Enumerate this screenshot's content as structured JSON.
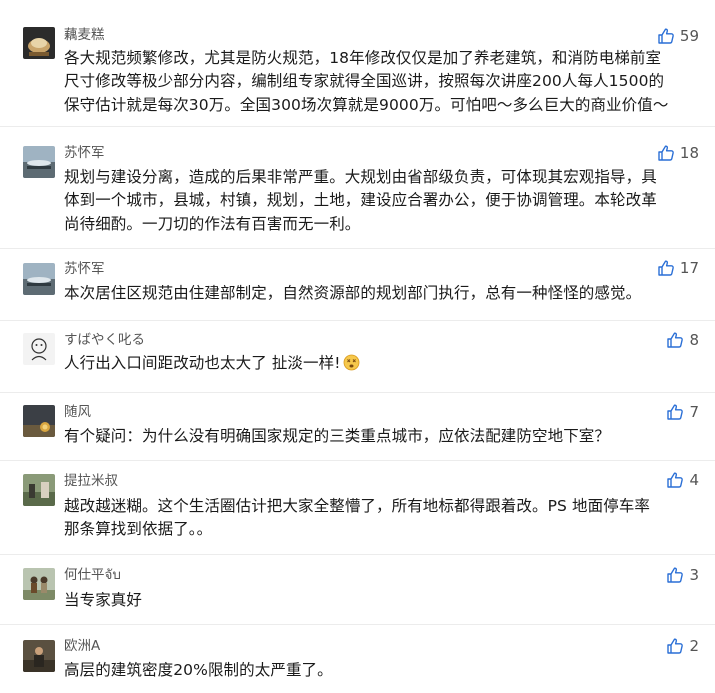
{
  "comments": [
    {
      "username": "藕麦糕",
      "likes": "59",
      "lines": [
        "各大规范频繁修改，尤其是防火规范，18年修改仅仅是加了养老建筑，和消防电梯前室",
        "尺寸修改等极少部分内容，编制组专家就得全国巡讲，按照每次讲座200人每人1500的",
        "保守估计就是每次30万。全国300场次算就是9000万。可怕吧～多么巨大的商业价值～"
      ]
    },
    {
      "username": "苏怀军",
      "likes": "18",
      "lines": [
        "规划与建设分离，造成的后果非常严重。大规划由省部级负责，可体现其宏观指导，具",
        "体到一个城市，县城，村镇，规划，土地，建设应合署办公，便于协调管理。本轮改革",
        "尚待细酌。一刀切的作法有百害而无一利。"
      ]
    },
    {
      "username": "苏怀军",
      "likes": "17",
      "lines": [
        "本次居住区规范由住建部制定，自然资源部的规划部门执行，总有一种怪怪的感觉。"
      ]
    },
    {
      "username": "すばやく叱る",
      "likes": "8",
      "lines": [
        "人行出入口间距改动也太大了 扯淡一样!"
      ],
      "emoji": "dizzy-face-emoji"
    },
    {
      "username": "随风",
      "likes": "7",
      "lines": [
        "有个疑问：为什么没有明确国家规定的三类重点城市，应依法配建防空地下室？"
      ]
    },
    {
      "username": "提拉米叔",
      "likes": "4",
      "lines": [
        "越改越迷糊。这个生活圈估计把大家全整懵了，所有地标都得跟着改。PS 地面停车率",
        "那条算找到依据了。。"
      ]
    },
    {
      "username": "何仕平จับ",
      "likes": "3",
      "lines": [
        "当专家真好"
      ]
    },
    {
      "username": "欧洲A",
      "likes": "2",
      "lines": [
        "高层的建筑密度20%限制的太严重了。"
      ]
    }
  ],
  "colors": {
    "accent_like": "#2a6fd6",
    "username": "#555555",
    "text": "#1a1a1a",
    "divider": "#ececec"
  },
  "icons": {
    "like": "thumbs-up-icon"
  }
}
